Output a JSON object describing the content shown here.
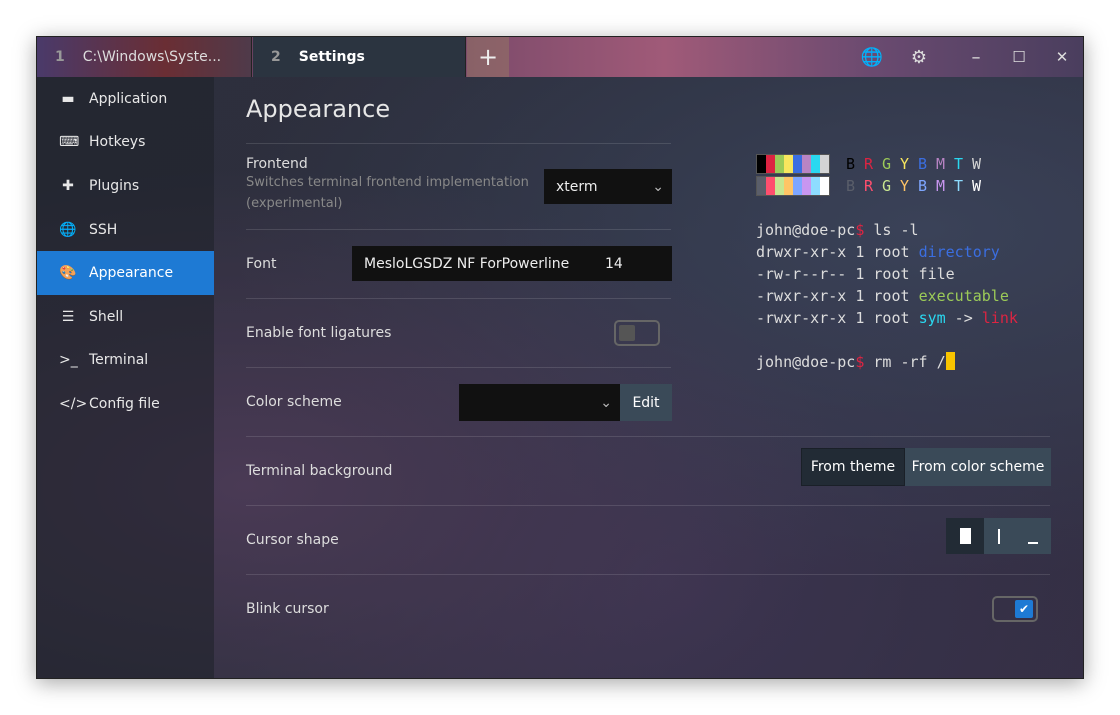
{
  "tabs": [
    {
      "num": "1",
      "label": "C:\\Windows\\Syste..."
    },
    {
      "num": "2",
      "label": "Settings"
    }
  ],
  "tabbar": {
    "new_tab": "+",
    "globe_icon": "🌐",
    "settings_icon": "⚙",
    "minimize": "–",
    "maximize": "☐",
    "close": "✕"
  },
  "sidebar": {
    "items": [
      {
        "label": "Application",
        "icon": "▬"
      },
      {
        "label": "Hotkeys",
        "icon": "⌨"
      },
      {
        "label": "Plugins",
        "icon": "✚"
      },
      {
        "label": "SSH",
        "icon": "🌐"
      },
      {
        "label": "Appearance",
        "icon": "🎨"
      },
      {
        "label": "Shell",
        "icon": "☰"
      },
      {
        "label": "Terminal",
        "icon": ">_"
      },
      {
        "label": "Config file",
        "icon": "</>"
      }
    ],
    "active": "Appearance"
  },
  "main": {
    "title": "Appearance",
    "frontend": {
      "label": "Frontend",
      "desc1": "Switches terminal frontend implementation",
      "desc2": "(experimental)",
      "value": "xterm"
    },
    "font": {
      "label": "Font",
      "value": "MesloLGSDZ NF ForPowerline",
      "size": "14"
    },
    "ligatures": {
      "label": "Enable font ligatures",
      "enabled": false
    },
    "color_scheme": {
      "label": "Color scheme",
      "value": "",
      "edit": "Edit"
    },
    "terminal_background": {
      "label": "Terminal background",
      "options": [
        "From theme",
        "From color scheme"
      ],
      "selected": "From theme"
    },
    "cursor_shape": {
      "label": "Cursor shape",
      "options": [
        "block",
        "beam",
        "underline"
      ],
      "selected": "block"
    },
    "blink": {
      "label": "Blink cursor",
      "enabled": true
    }
  },
  "preview": {
    "palette_top": [
      "#000000",
      "#dc2442",
      "#9ccb58",
      "#f8e65e",
      "#3b6ee0",
      "#b884c4",
      "#2ad8f0",
      "#d4d4d4"
    ],
    "palette_bottom": [
      "#5a5e6a",
      "#ff4f6e",
      "#c8e690",
      "#ffc566",
      "#7ea6ff",
      "#c896f0",
      "#8edcff",
      "#ffffff"
    ],
    "letters": [
      "B",
      "R",
      "G",
      "Y",
      "B",
      "M",
      "T",
      "W"
    ],
    "lines": [
      [
        {
          "t": "john@doe-pc",
          "c": "#dddddd"
        },
        {
          "t": "$",
          "c": "#dc2442"
        },
        {
          "t": " ls -l",
          "c": "#dddddd"
        }
      ],
      [
        {
          "t": "drwxr-xr-x 1 root ",
          "c": "#dddddd"
        },
        {
          "t": "directory",
          "c": "#3b6ee0"
        }
      ],
      [
        {
          "t": "-rw-r--r-- 1 root file",
          "c": "#dddddd"
        }
      ],
      [
        {
          "t": "-rwxr-xr-x 1 root ",
          "c": "#dddddd"
        },
        {
          "t": "executable",
          "c": "#9ccb58"
        }
      ],
      [
        {
          "t": "-rwxr-xr-x 1 root ",
          "c": "#dddddd"
        },
        {
          "t": "sym",
          "c": "#2ad8f0"
        },
        {
          "t": " -> ",
          "c": "#dddddd"
        },
        {
          "t": "link",
          "c": "#dc2442"
        }
      ],
      [
        {
          "t": " ",
          "c": "#dddddd"
        }
      ],
      [
        {
          "t": "john@doe-pc",
          "c": "#dddddd"
        },
        {
          "t": "$",
          "c": "#dc2442"
        },
        {
          "t": " rm -rf /",
          "c": "#dddddd"
        }
      ]
    ],
    "cursor_color": "#f8c400"
  },
  "colors": {
    "accent": "#1e7ad4"
  }
}
